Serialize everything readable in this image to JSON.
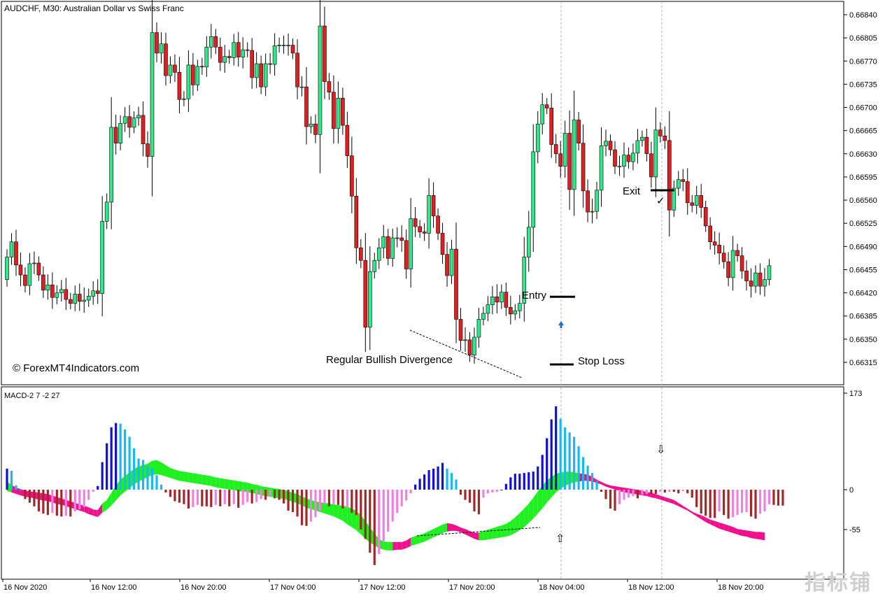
{
  "header": {
    "title": "AUDCHF, M30:  Australian Dollar vs Swiss Franc"
  },
  "copyright": "© ForexMT4Indicators.com",
  "watermark": "指标铺",
  "colors": {
    "bull": "#2ee88a",
    "bear": "#e02020",
    "macd_pos_strong": "#1010d0",
    "macd_pos_weak": "#1ab8f0",
    "macd_neg_strong": "#a02828",
    "macd_neg_weak": "#f080e0",
    "cloud_green": "#20f020",
    "cloud_pink": "#f0108c"
  },
  "chart_data": [
    {
      "type": "candlestick",
      "title": "AUDCHF, M30:  Australian Dollar vs Swiss Franc",
      "y_ticks": [
        "0.66840",
        "0.66805",
        "0.66770",
        "0.66735",
        "0.66700",
        "0.66665",
        "0.66630",
        "0.66595",
        "0.66560",
        "0.66525",
        "0.66490",
        "0.66455",
        "0.66420",
        "0.66385",
        "0.66350",
        "0.66315"
      ],
      "ylim": [
        0.66305,
        0.66855
      ],
      "x_ticks": [
        "16 Nov 2020",
        "16 Nov 12:00",
        "16 Nov 20:00",
        "17 Nov 04:00",
        "17 Nov 12:00",
        "17 Nov 20:00",
        "18 Nov 04:00",
        "18 Nov 12:00",
        "18 Nov 20:00"
      ],
      "closes": [
        0.66474,
        0.66497,
        0.66462,
        0.66447,
        0.66431,
        0.66464,
        0.66465,
        0.66447,
        0.66424,
        0.66432,
        0.66413,
        0.6642,
        0.66425,
        0.6641,
        0.66404,
        0.66418,
        0.66407,
        0.66409,
        0.66415,
        0.66423,
        0.66419,
        0.66528,
        0.66557,
        0.6667,
        0.66646,
        0.66676,
        0.66686,
        0.6667,
        0.66684,
        0.66688,
        0.66645,
        0.66626,
        0.66813,
        0.66782,
        0.66796,
        0.66748,
        0.66764,
        0.66753,
        0.66712,
        0.66713,
        0.66764,
        0.66734,
        0.66762,
        0.66761,
        0.66791,
        0.66807,
        0.66791,
        0.66768,
        0.66777,
        0.66775,
        0.66798,
        0.66776,
        0.66787,
        0.66786,
        0.66745,
        0.66766,
        0.66731,
        0.66766,
        0.66765,
        0.66793,
        0.66794,
        0.66794,
        0.66794,
        0.66782,
        0.66731,
        0.66731,
        0.66671,
        0.66675,
        0.66659,
        0.66823,
        0.66739,
        0.66723,
        0.66668,
        0.66714,
        0.66673,
        0.66627,
        0.66566,
        0.66488,
        0.66469,
        0.66368,
        0.66452,
        0.66469,
        0.66488,
        0.66505,
        0.66472,
        0.66503,
        0.66503,
        0.66499,
        0.66456,
        0.66532,
        0.6652,
        0.66512,
        0.6651,
        0.66567,
        0.66536,
        0.6651,
        0.66478,
        0.66446,
        0.66486,
        0.6638,
        0.66348,
        0.66349,
        0.66326,
        0.66353,
        0.6638,
        0.66389,
        0.66402,
        0.66414,
        0.66406,
        0.66421,
        0.66398,
        0.66388,
        0.66393,
        0.66404,
        0.66474,
        0.66519,
        0.66633,
        0.66675,
        0.66704,
        0.66699,
        0.66644,
        0.6663,
        0.66611,
        0.66661,
        0.66576,
        0.66681,
        0.66646,
        0.66574,
        0.66542,
        0.66543,
        0.66575,
        0.66642,
        0.66649,
        0.66636,
        0.66611,
        0.66611,
        0.66628,
        0.66618,
        0.66631,
        0.6665,
        0.66655,
        0.6663,
        0.66595,
        0.66666,
        0.66657,
        0.6665,
        0.66545,
        0.66578,
        0.66591,
        0.66588,
        0.66556,
        0.66552,
        0.66567,
        0.66549,
        0.66521,
        0.66497,
        0.66492,
        0.6648,
        0.66467,
        0.66443,
        0.66484,
        0.66476,
        0.66453,
        0.66438,
        0.6643,
        0.6645,
        0.6643,
        0.6644,
        0.66461
      ],
      "series": [
        {
          "name": "Regular Bullish Divergence",
          "type": "line",
          "points": [
            [
              "17 Nov 12:00",
              0.6637
            ],
            [
              "18 Nov 02:30",
              0.66302
            ]
          ]
        }
      ],
      "annotations": [
        {
          "text": "Entry",
          "price": 0.66414
        },
        {
          "text": "Stop Loss",
          "price": 0.66318
        },
        {
          "text": "Exit",
          "price": 0.66572
        },
        {
          "text": "Regular Bullish Divergence"
        }
      ]
    },
    {
      "type": "bar",
      "title": "MACD-2 7 -2 27",
      "y_ticks": [
        "173",
        "0",
        "-55"
      ],
      "ylim": [
        -110,
        173
      ],
      "histogram": [
        29,
        26,
        6,
        0,
        -13,
        -18,
        -23,
        -30,
        -33,
        -35,
        -32,
        -36,
        -37,
        -36,
        -37,
        -30,
        -27,
        -24,
        -14,
        -3,
        5,
        38,
        64,
        86,
        92,
        91,
        83,
        73,
        57,
        43,
        41,
        33,
        30,
        20,
        7,
        -4,
        -10,
        -16,
        -18,
        -20,
        -26,
        -24,
        -21,
        -23,
        -23,
        -24,
        -21,
        -23,
        -20,
        -23,
        -20,
        -25,
        -21,
        -17,
        -19,
        -17,
        -13,
        -14,
        -10,
        -12,
        -14,
        -19,
        -29,
        -31,
        -37,
        -49,
        -50,
        -44,
        -38,
        -29,
        -20,
        -23,
        -20,
        -21,
        -26,
        -25,
        -32,
        -35,
        -55,
        -68,
        -87,
        -104,
        -89,
        -72,
        -58,
        -44,
        -32,
        -23,
        -15,
        -5,
        7,
        15,
        21,
        27,
        29,
        32,
        37,
        29,
        23,
        14,
        -7,
        -14,
        -18,
        -30,
        -34,
        -11,
        -5,
        -4,
        -3,
        0,
        8,
        17,
        22,
        22,
        23,
        24,
        25,
        32,
        48,
        71,
        97,
        115,
        98,
        86,
        79,
        73,
        60,
        45,
        33,
        23,
        12,
        -3,
        -13,
        -26,
        -29,
        -20,
        -14,
        -11,
        -9,
        -12,
        -7,
        -6,
        -6,
        -6,
        -3,
        -4,
        -3,
        -3,
        -5,
        -2,
        -5,
        -11,
        -24,
        -33,
        -36,
        -39,
        -39,
        -30,
        -35,
        -40,
        -38,
        -35,
        -32,
        -31,
        -37,
        -40,
        -33,
        -30,
        -20,
        -21,
        -22,
        -22
      ],
      "series": [
        {
          "name": "MACD",
          "values": [
            25,
            21,
            17,
            15,
            13,
            12,
            11,
            10,
            9,
            8,
            6,
            4,
            2,
            0,
            -2,
            -4,
            -6,
            -8,
            -10,
            -13,
            -14,
            -5,
            0,
            10,
            20,
            28,
            33,
            38,
            43,
            46,
            48,
            50,
            54,
            55,
            52,
            48,
            44,
            42,
            40,
            39,
            38,
            37,
            36,
            35,
            34,
            33,
            31,
            30,
            29,
            28,
            27,
            26,
            25,
            24,
            22,
            21,
            19,
            18,
            17,
            16,
            15,
            14,
            12,
            10,
            8,
            5,
            2,
            0,
            -2,
            -3,
            -4,
            -5,
            -6,
            -7,
            -8,
            -9,
            -12,
            -15,
            -21,
            -29,
            -38,
            -46,
            -54,
            -57,
            -58,
            -58,
            -58,
            -58,
            -56,
            -52,
            -50,
            -48,
            -46,
            -43,
            -40,
            -37,
            -34,
            -32,
            -33,
            -35,
            -38,
            -40,
            -43,
            -45,
            -45,
            -43,
            -41,
            -39,
            -37,
            -35,
            -33,
            -29,
            -24,
            -18,
            -12,
            -5,
            3,
            12,
            20,
            27,
            32,
            36,
            38,
            39,
            39,
            38,
            37,
            36,
            35,
            32,
            28,
            25,
            22,
            20,
            19,
            18,
            17,
            16,
            15,
            14,
            13,
            11,
            10,
            8,
            6,
            4,
            2,
            0,
            -4,
            -8,
            -12,
            -16,
            -19,
            -21,
            -24,
            -27,
            -29,
            -31,
            -33,
            -35,
            -37,
            -40,
            -41,
            -42,
            -43,
            -44,
            -44,
            -45
          ],
          "color": "#20f020"
        },
        {
          "name": "Signal",
          "values": [
            24,
            22,
            20,
            18,
            16,
            15,
            14,
            12,
            11,
            10,
            8,
            6,
            5,
            3,
            1,
            -1,
            -3,
            -5,
            -8,
            -10,
            -12,
            -6,
            -2,
            4,
            11,
            18,
            23,
            28,
            33,
            37,
            40,
            43,
            46,
            47,
            46,
            44,
            42,
            40,
            38,
            37,
            36,
            35,
            34,
            33,
            32,
            31,
            29,
            28,
            27,
            26,
            25,
            24,
            23,
            22,
            21,
            20,
            18,
            17,
            16,
            15,
            14,
            13,
            11,
            9,
            7,
            4,
            1,
            -1,
            -3,
            -5,
            -7,
            -9,
            -11,
            -14,
            -17,
            -22,
            -26,
            -30,
            -36,
            -42,
            -47,
            -51,
            -55,
            -57,
            -58,
            -58,
            -57,
            -57,
            -55,
            -52,
            -50,
            -48,
            -46,
            -43,
            -40,
            -37,
            -34,
            -32,
            -31,
            -31,
            -33,
            -36,
            -39,
            -42,
            -44,
            -44,
            -43,
            -42,
            -41,
            -40,
            -39,
            -37,
            -34,
            -30,
            -26,
            -20,
            -14,
            -7,
            0,
            8,
            15,
            22,
            27,
            31,
            34,
            36,
            37,
            38,
            38,
            37,
            35,
            33,
            30,
            28,
            26,
            24,
            22,
            21,
            20,
            19,
            18,
            17,
            15,
            14,
            12,
            10,
            8,
            6,
            3,
            0,
            -3,
            -7,
            -11,
            -15,
            -19,
            -22,
            -25,
            -28,
            -30,
            -32,
            -34,
            -36,
            -38,
            -39,
            -41,
            -42,
            -43,
            -44,
            -45,
            -46
          ],
          "color": "#f0108c"
        }
      ]
    }
  ]
}
